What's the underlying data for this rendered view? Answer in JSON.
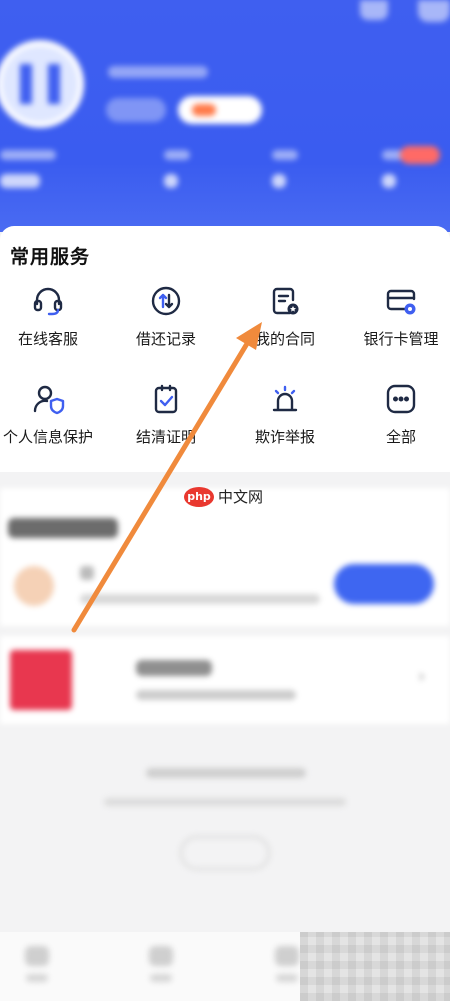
{
  "colors": {
    "brand_blue": "#3f5ff0",
    "arrow_orange": "#f08a3c",
    "watermark_red": "#e9382f",
    "icon_dark": "#1f2a44"
  },
  "services": {
    "title": "常用服务",
    "items": [
      {
        "label": "在线客服",
        "icon": "headset-icon"
      },
      {
        "label": "借还记录",
        "icon": "exchange-icon"
      },
      {
        "label": "我的合同",
        "icon": "contract-icon"
      },
      {
        "label": "银行卡管理",
        "icon": "bank-card-icon"
      },
      {
        "label": "个人信息保护",
        "icon": "user-shield-icon"
      },
      {
        "label": "结清证明",
        "icon": "settlement-proof-icon"
      },
      {
        "label": "欺诈举报",
        "icon": "alarm-icon"
      },
      {
        "label": "全部",
        "icon": "more-icon"
      }
    ]
  },
  "watermark": {
    "logo": "php",
    "text": "中文网"
  },
  "annotation": {
    "type": "arrow",
    "points_to": "我的合同"
  }
}
